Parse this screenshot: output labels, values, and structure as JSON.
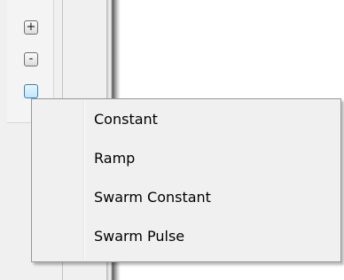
{
  "toolbar": {
    "buttons": [
      {
        "glyph": "+",
        "icon": "plus-icon"
      },
      {
        "glyph": "-",
        "icon": "minus-icon"
      },
      {
        "glyph": "",
        "icon": "dropdown-icon"
      }
    ]
  },
  "context_menu": {
    "items": [
      {
        "label": "Constant"
      },
      {
        "label": "Ramp"
      },
      {
        "label": "Swarm Constant"
      },
      {
        "label": "Swarm Pulse"
      }
    ]
  },
  "colors": {
    "menu_background": "#f0f0f0",
    "menu_border": "#979797",
    "active_button_border": "#3c7fb1"
  }
}
